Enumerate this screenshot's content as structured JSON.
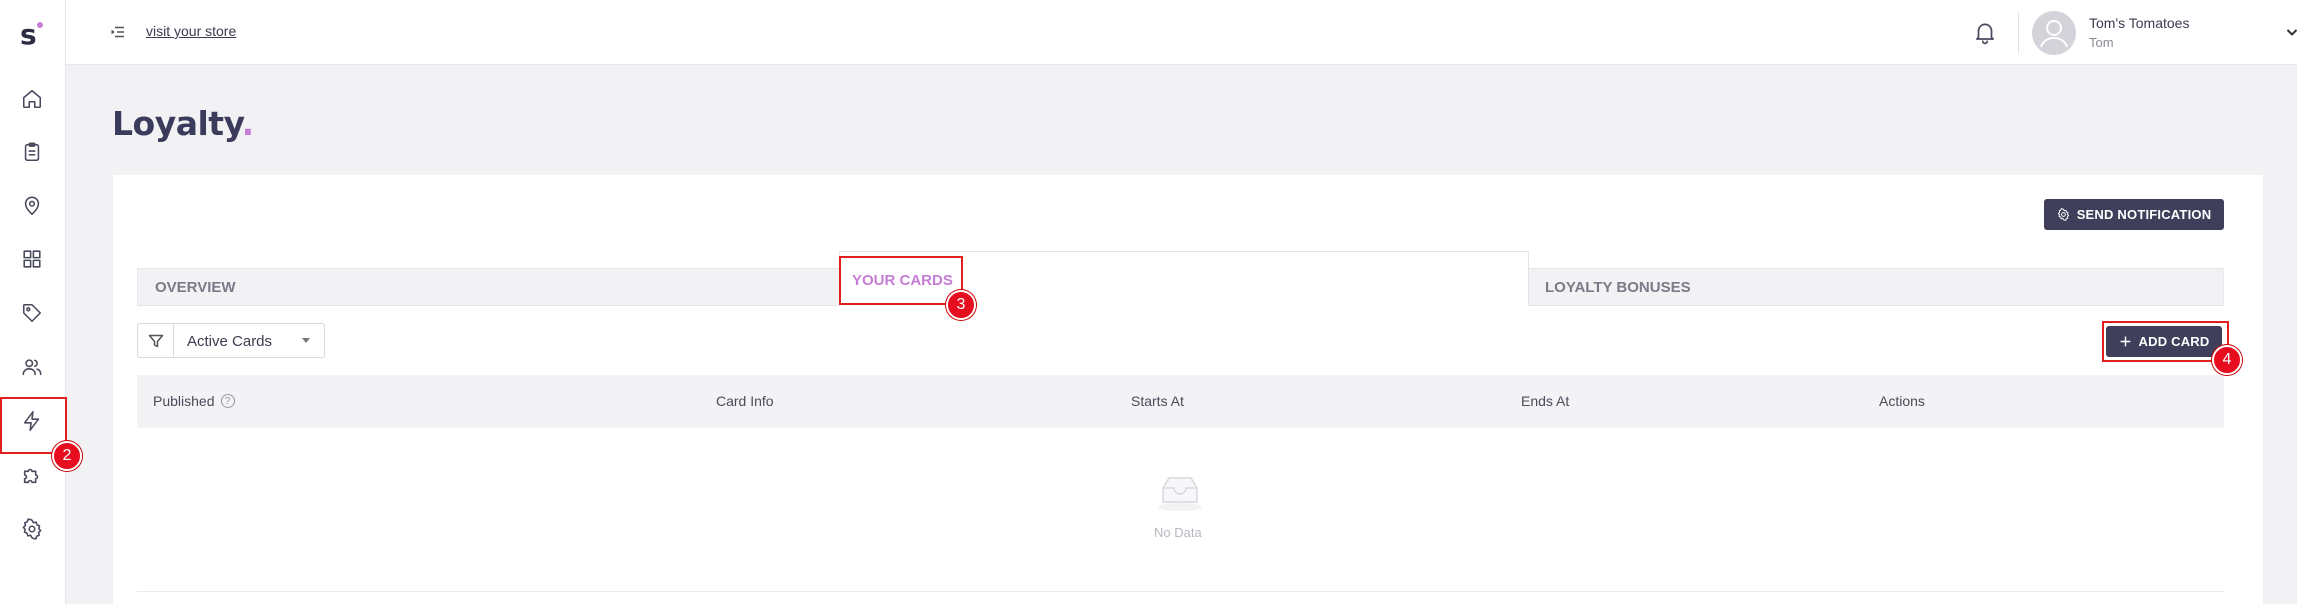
{
  "sidebar": {
    "logo_letter": "s",
    "items": [
      {
        "name": "home-icon"
      },
      {
        "name": "clipboard-icon"
      },
      {
        "name": "location-pin-icon"
      },
      {
        "name": "grid-icon"
      },
      {
        "name": "tag-icon"
      },
      {
        "name": "users-icon"
      },
      {
        "name": "lightning-icon"
      },
      {
        "name": "puzzle-icon"
      },
      {
        "name": "gear-icon"
      }
    ]
  },
  "topbar": {
    "visit_store": "visit your store",
    "user_name": "Tom's Tomatoes",
    "user_sub": "Tom"
  },
  "page": {
    "title": "Loyalty",
    "title_dot": "."
  },
  "actions": {
    "send_notification": "SEND NOTIFICATION",
    "add_card": "ADD CARD"
  },
  "tabs": [
    {
      "label": "OVERVIEW"
    },
    {
      "label": "YOUR CARDS"
    },
    {
      "label": "LOYALTY BONUSES"
    }
  ],
  "filter": {
    "value": "Active Cards"
  },
  "table": {
    "columns": [
      "Published",
      "Card Info",
      "Starts At",
      "Ends At",
      "Actions"
    ],
    "empty_text": "No Data"
  },
  "annotations": {
    "step_2": "2",
    "step_3": "3",
    "step_4": "4"
  },
  "colors": {
    "accent": "#c77dd6",
    "button_dark": "#3f3f5c",
    "highlight": "#e02020"
  }
}
